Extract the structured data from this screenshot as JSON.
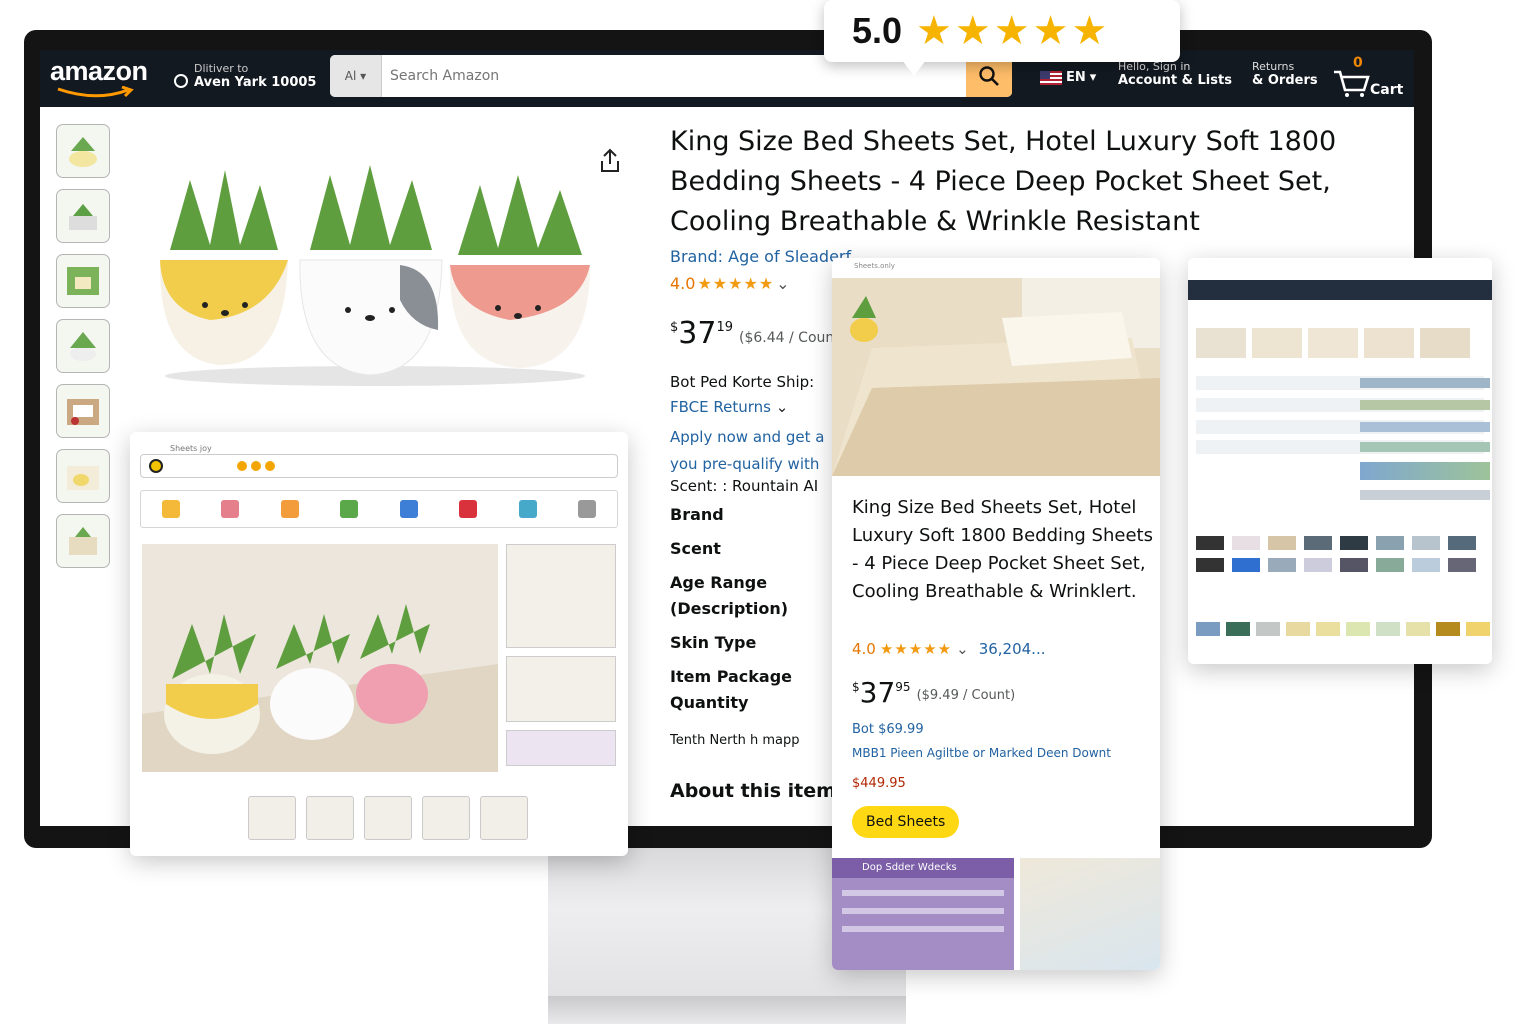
{
  "badge": {
    "rating": "5.0",
    "stars": "★★★★★"
  },
  "nav": {
    "logo": "amazon",
    "deliver_line1": "Dlitiver to",
    "deliver_line2": "Aven Yark 10005",
    "search_category": "Al",
    "search_placeholder": "Search Amazon",
    "lang": "EN",
    "account_line1": "Hello, Sign in",
    "account_line2": "Account & Lists",
    "orders_line1": "Returns",
    "orders_line2": "& Orders",
    "cart_count": "0",
    "cart_label": "Cart"
  },
  "product": {
    "title": "King Size Bed Sheets Set, Hotel Luxury Soft 1800 Bedding Sheets - 4 Piece Deep Pocket Sheet Set, Cooling Breathable & Wrinkle Resistant",
    "brand_link": "Brand: Age of Sleaderf",
    "rating_value": "4.0",
    "stars": "★★★★★",
    "price_whole": "37",
    "price_fraction": "19",
    "price_unit": "($6.44 / Count)",
    "ship_label": "Bot Ped Korte Ship:",
    "returns": "FBCE Returns",
    "apply_text": "Apply now and get a you pre-qualify with",
    "scent_line": "Scent: : Rountain AI",
    "specs": [
      "Brand",
      "Scent",
      "Age Range (Description)",
      "Skin Type",
      "Item Package Quantity"
    ],
    "tenth_line": "Tenth Nerth h mapp",
    "about_heading": "About this item"
  },
  "card_a": {
    "header_label": "Sheets joy"
  },
  "card_b": {
    "top_label": "Sheets.only",
    "title": "King Size Bed Sheets Set, Hotel Luxury Soft 1800 Bedding Sheets - 4 Piece Deep Pocket Sheet Set, Cooling Breathable & Wrinklert.",
    "rating_value": "4.0",
    "stars": "★★★★★",
    "review_count": "36,204...",
    "price_whole": "37",
    "price_fraction": "95",
    "price_unit": "($9.49 / Count)",
    "line1": "Bot $69.99",
    "line2": "MBB1 Pieen Agiltbe or Marked Deen Downt",
    "line3": "$449.95",
    "button": "Bed Sheets",
    "purple_header": "Dop Sdder Wdecks"
  },
  "colors": {
    "nav_bg": "#131921",
    "search_btn": "#febd69",
    "link": "#2162a1",
    "star": "#f29b12",
    "buy_btn": "#ffd814"
  }
}
